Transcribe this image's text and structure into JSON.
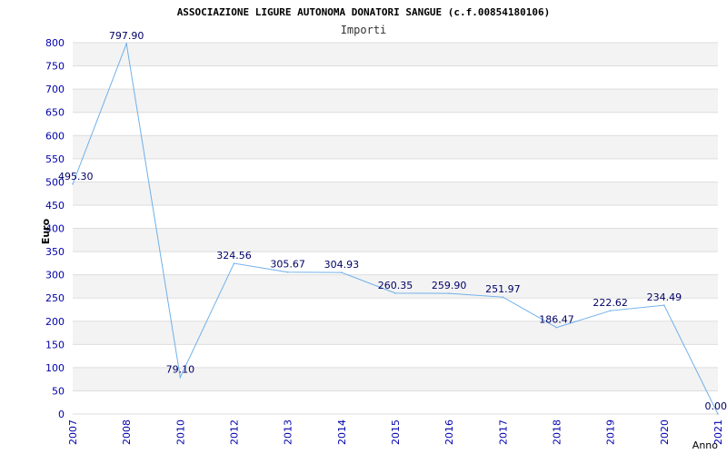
{
  "chart_data": {
    "type": "line",
    "title": "ASSOCIAZIONE LIGURE AUTONOMA DONATORI SANGUE (c.f.00854180106)",
    "subtitle": "Importi",
    "xlabel": "Anno",
    "ylabel": "Euro",
    "ylim": [
      0,
      800
    ],
    "yticks": [
      "0",
      "50",
      "100",
      "150",
      "200",
      "250",
      "300",
      "350",
      "400",
      "450",
      "500",
      "550",
      "600",
      "650",
      "700",
      "750",
      "800"
    ],
    "categories": [
      "2007",
      "2008",
      "2010",
      "2012",
      "2013",
      "2014",
      "2015",
      "2016",
      "2017",
      "2018",
      "2019",
      "2020",
      "2021"
    ],
    "series": [
      {
        "values": [
          495.3,
          797.9,
          79.1,
          324.56,
          305.67,
          304.93,
          260.35,
          259.9,
          251.97,
          186.47,
          222.62,
          234.49,
          0.0
        ],
        "labels": [
          "495.30",
          "797.90",
          "79.10",
          "324.56",
          "305.67",
          "304.93",
          "260.35",
          "259.90",
          "251.97",
          "186.47",
          "222.62",
          "234.49",
          "0.00"
        ]
      }
    ],
    "grid": true,
    "colors": {
      "line": "#6fb0ea",
      "band": "#f3f3f3",
      "gridline": "#dddddd",
      "axis_text": "#0000aa",
      "label_text": "#000066",
      "title_text": "#000000"
    }
  }
}
